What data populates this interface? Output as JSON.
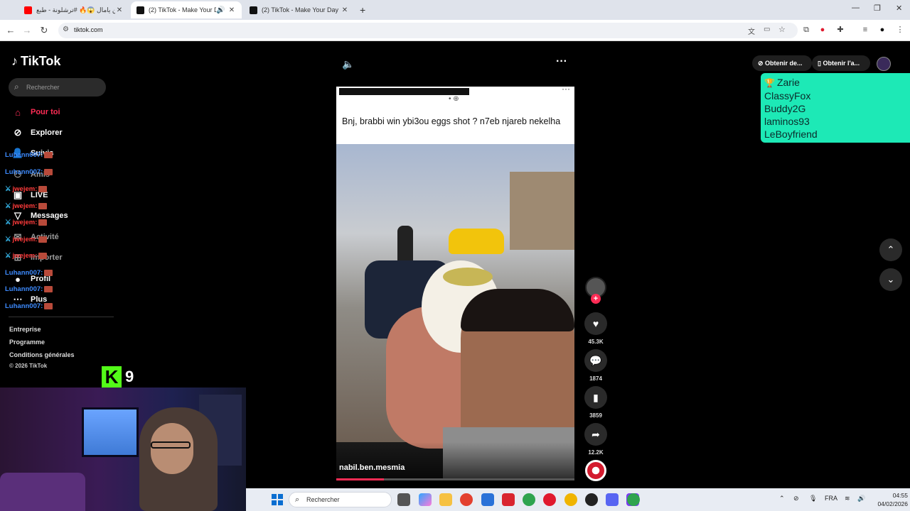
{
  "browser": {
    "tabs": [
      {
        "title": "لامين يامال 😱🔥 #ترشلونة - طبع",
        "active": false
      },
      {
        "title": "(2) TikTok - Make Your Day",
        "active": true
      },
      {
        "title": "(2) TikTok - Make Your Day",
        "active": false
      }
    ],
    "new_tab": "+",
    "url": "tiktok.com"
  },
  "sidebar": {
    "logo": "TikTok",
    "search_placeholder": "Rechercher",
    "items": [
      {
        "label": "Pour toi",
        "icon": "home-icon",
        "active": true
      },
      {
        "label": "Explorer",
        "icon": "compass-icon"
      },
      {
        "label": "Suivis",
        "icon": "user-icon"
      },
      {
        "label": "Amis",
        "icon": "friends-icon"
      },
      {
        "label": "LIVE",
        "icon": "live-icon"
      },
      {
        "label": "Messages",
        "icon": "messages-icon"
      },
      {
        "label": "Activité",
        "icon": "activity-icon"
      },
      {
        "label": "Importer",
        "icon": "upload-icon"
      },
      {
        "label": "Profil",
        "icon": "profile-icon"
      },
      {
        "label": "Plus",
        "icon": "more-icon"
      }
    ],
    "footer": [
      "Entreprise",
      "Programme",
      "Conditions générales"
    ],
    "copyright": "© 2026 TikTok"
  },
  "chat": [
    {
      "user": "Luhann007:",
      "color": "blue",
      "sword": false
    },
    {
      "user": "Luhann007:",
      "color": "blue",
      "sword": false
    },
    {
      "user": "jwejem:",
      "color": "red",
      "sword": true
    },
    {
      "user": "jwejem:",
      "color": "red",
      "sword": true
    },
    {
      "user": "jwejem:",
      "color": "red",
      "sword": true
    },
    {
      "user": "jwejem:",
      "color": "red",
      "sword": true
    },
    {
      "user": "jwejem:",
      "color": "red",
      "sword": true
    },
    {
      "user": "Luhann007:",
      "color": "blue",
      "sword": false
    },
    {
      "user": "Luhann007:",
      "color": "blue",
      "sword": false
    },
    {
      "user": "Luhann007:",
      "color": "blue",
      "sword": false
    }
  ],
  "kick": {
    "logo": "K",
    "viewers": "9"
  },
  "video": {
    "caption": "Bnj,  brabbi win ybi3ou eggs shot ? n7eb njareb nekelha",
    "author": "nabil.ben.mesmia",
    "progress": 0.2
  },
  "actions": {
    "likes": "45.3K",
    "comments": "1874",
    "saves": "3859",
    "shares": "12.2K"
  },
  "top_right": {
    "pill1": "Obtenir de...",
    "pill2": "Obtenir l'a..."
  },
  "leaderboard": [
    "Zarie",
    "ClassyFox",
    "Buddy2G",
    "laminos93",
    "LeBoyfriend"
  ],
  "taskbar": {
    "search": "Rechercher",
    "lang": "FRA",
    "time": "04:55",
    "date": "04/02/2026"
  },
  "colors": {
    "accent": "#fe2c55",
    "leaderboard_bg": "#1de9b6",
    "kick_green": "#53fc18"
  }
}
